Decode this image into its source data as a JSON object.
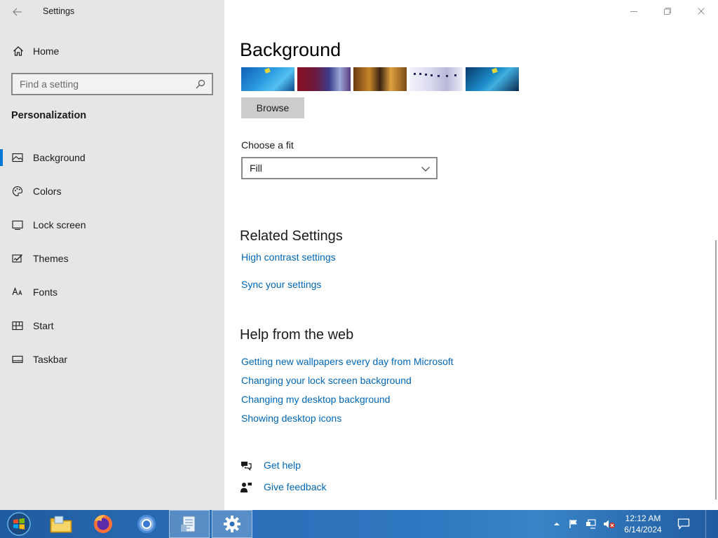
{
  "window": {
    "title": "Settings",
    "controls": [
      "minimize",
      "restore",
      "close"
    ]
  },
  "sidebar": {
    "home_label": "Home",
    "search_placeholder": "Find a setting",
    "section_title": "Personalization",
    "items": [
      {
        "label": "Background",
        "icon": "picture-icon",
        "selected": true
      },
      {
        "label": "Colors",
        "icon": "palette-icon",
        "selected": false
      },
      {
        "label": "Lock screen",
        "icon": "lock-screen-icon",
        "selected": false
      },
      {
        "label": "Themes",
        "icon": "themes-icon",
        "selected": false
      },
      {
        "label": "Fonts",
        "icon": "fonts-icon",
        "selected": false
      },
      {
        "label": "Start",
        "icon": "start-icon",
        "selected": false
      },
      {
        "label": "Taskbar",
        "icon": "taskbar-icon",
        "selected": false
      }
    ]
  },
  "main": {
    "title": "Background",
    "browse_label": "Browse",
    "fit_label": "Choose a fit",
    "fit_value": "Fill",
    "related_title": "Related Settings",
    "related_links": [
      "High contrast settings",
      "Sync your settings"
    ],
    "help_title": "Help from the web",
    "help_links": [
      "Getting new wallpapers every day from Microsoft",
      "Changing your lock screen background",
      "Changing my desktop background",
      "Showing desktop icons"
    ],
    "get_help": "Get help",
    "give_feedback": "Give feedback"
  },
  "taskbar": {
    "time": "12:12 AM",
    "date": "6/14/2024",
    "apps": [
      "start-orb",
      "file-explorer",
      "firefox",
      "chrome",
      "notepad-doc",
      "settings"
    ],
    "tray_icons": [
      "show-hidden-icons",
      "action-center-flag",
      "network",
      "volume-muted",
      "notifications"
    ]
  },
  "colors": {
    "accent": "#0078d7",
    "link": "#0067b8",
    "sidebar_bg": "#e6e6e6",
    "taskbar": "#2a6fb8"
  }
}
